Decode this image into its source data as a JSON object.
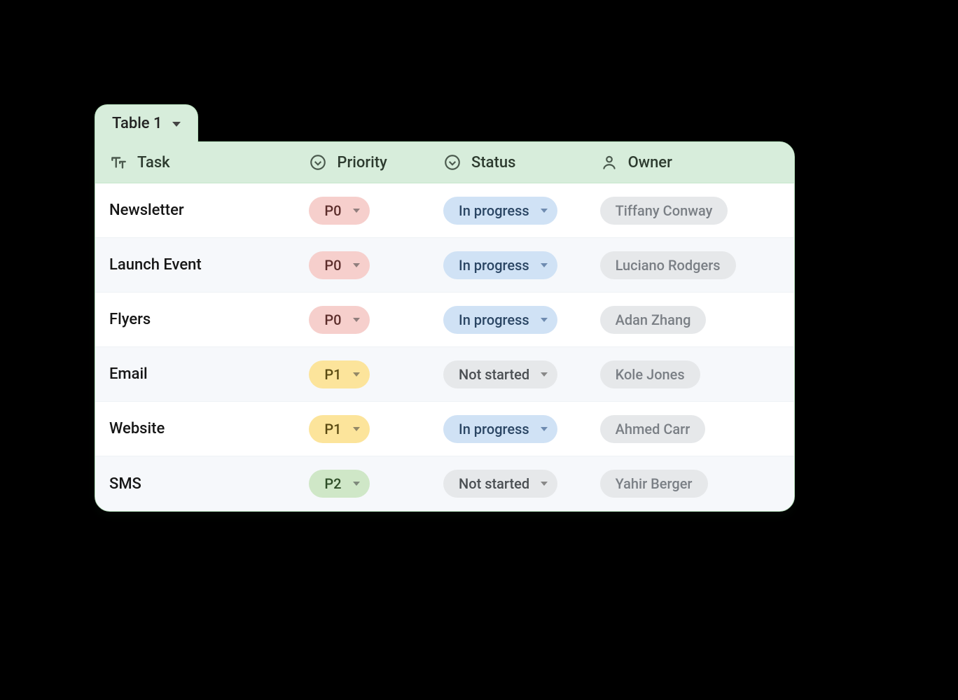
{
  "tab": {
    "label": "Table 1"
  },
  "columns": [
    {
      "key": "task",
      "label": "Task",
      "icon": "text"
    },
    {
      "key": "priority",
      "label": "Priority",
      "icon": "dropdown"
    },
    {
      "key": "status",
      "label": "Status",
      "icon": "dropdown"
    },
    {
      "key": "owner",
      "label": "Owner",
      "icon": "person"
    }
  ],
  "colors": {
    "priority": {
      "P0": "p-red",
      "P1": "p-yellow",
      "P2": "p-green"
    },
    "status": {
      "In progress": "p-blue",
      "Not started": "p-grey"
    }
  },
  "rows": [
    {
      "task": "Newsletter",
      "priority": "P0",
      "status": "In progress",
      "owner": "Tiffany Conway"
    },
    {
      "task": "Launch Event",
      "priority": "P0",
      "status": "In progress",
      "owner": "Luciano Rodgers"
    },
    {
      "task": "Flyers",
      "priority": "P0",
      "status": "In progress",
      "owner": "Adan Zhang"
    },
    {
      "task": "Email",
      "priority": "P1",
      "status": "Not started",
      "owner": "Kole Jones"
    },
    {
      "task": "Website",
      "priority": "P1",
      "status": "In progress",
      "owner": "Ahmed Carr"
    },
    {
      "task": "SMS",
      "priority": "P2",
      "status": "Not started",
      "owner": "Yahir Berger"
    }
  ]
}
